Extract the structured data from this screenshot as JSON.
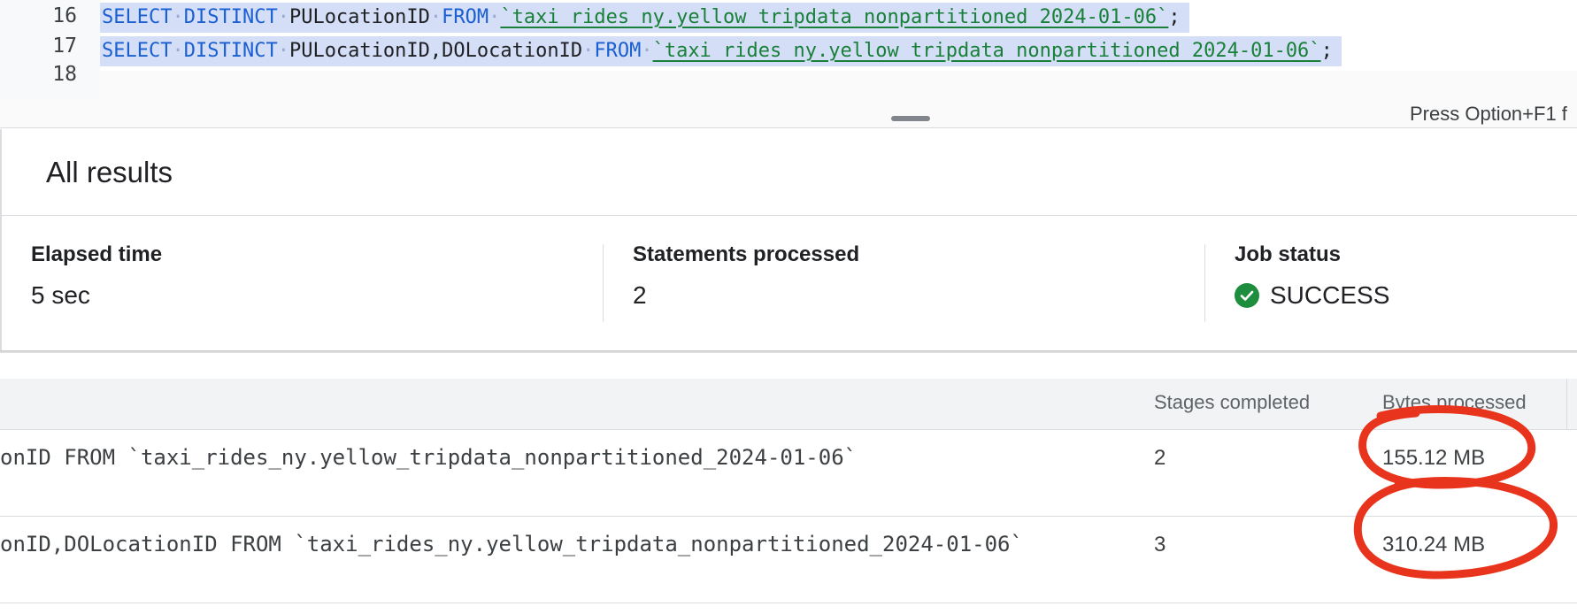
{
  "editor": {
    "lines": [
      {
        "number": "16",
        "tokens": [
          {
            "t": "SELECT",
            "c": "kw"
          },
          {
            "t": "·",
            "c": "dot"
          },
          {
            "t": "DISTINCT",
            "c": "kw"
          },
          {
            "t": "·",
            "c": "dot"
          },
          {
            "t": "PULocationID",
            "c": "id"
          },
          {
            "t": "·",
            "c": "dot"
          },
          {
            "t": "FROM",
            "c": "kw"
          },
          {
            "t": "·",
            "c": "dot"
          },
          {
            "t": "`taxi_rides_ny.yellow_tripdata_nonpartitioned_2024-01-06`",
            "c": "tb"
          },
          {
            "t": ";",
            "c": "id"
          }
        ]
      },
      {
        "number": "17",
        "tokens": [
          {
            "t": "SELECT",
            "c": "kw"
          },
          {
            "t": "·",
            "c": "dot"
          },
          {
            "t": "DISTINCT",
            "c": "kw"
          },
          {
            "t": "·",
            "c": "dot"
          },
          {
            "t": "PULocationID,DOLocationID",
            "c": "id"
          },
          {
            "t": "·",
            "c": "dot"
          },
          {
            "t": "FROM",
            "c": "kw"
          },
          {
            "t": "·",
            "c": "dot"
          },
          {
            "t": "`taxi_rides_ny.yellow_tripdata_nonpartitioned_2024-01-06`",
            "c": "tb"
          },
          {
            "t": ";",
            "c": "id"
          }
        ]
      },
      {
        "number": "18",
        "tokens": []
      }
    ],
    "hint": "Press Option+F1 f"
  },
  "results": {
    "title": "All results",
    "stats": {
      "elapsed_label": "Elapsed time",
      "elapsed_value": "5 sec",
      "statements_label": "Statements processed",
      "statements_value": "2",
      "job_label": "Job status",
      "job_value": "SUCCESS"
    }
  },
  "table": {
    "headers": {
      "stages": "Stages completed",
      "bytes": "Bytes processed"
    },
    "rows": [
      {
        "sql": "onID FROM `taxi_rides_ny.yellow_tripdata_nonpartitioned_2024-01-06`",
        "stages": "2",
        "bytes": "155.12 MB"
      },
      {
        "sql": "onID,DOLocationID FROM `taxi_rides_ny.yellow_tripdata_nonpartitioned_2024-01-06`",
        "stages": "3",
        "bytes": "310.24 MB"
      }
    ]
  },
  "colors": {
    "keyword": "#1a5fd1",
    "table_ref": "#188038",
    "selection": "#d4def6",
    "success": "#1e8e3e",
    "annotation": "#e8341c"
  },
  "icons": {
    "job_status": "check-circle-icon"
  }
}
